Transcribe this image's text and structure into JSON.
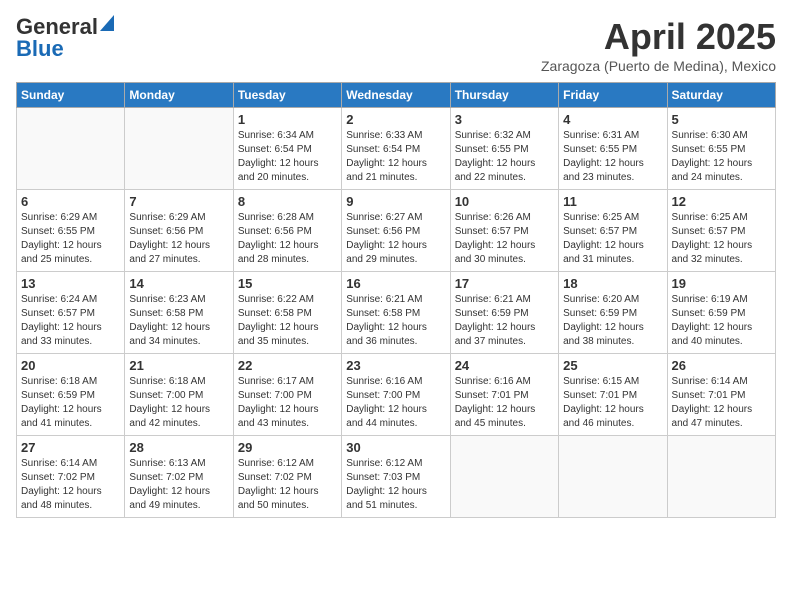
{
  "header": {
    "logo_general": "General",
    "logo_blue": "Blue",
    "month_title": "April 2025",
    "location": "Zaragoza (Puerto de Medina), Mexico"
  },
  "days_of_week": [
    "Sunday",
    "Monday",
    "Tuesday",
    "Wednesday",
    "Thursday",
    "Friday",
    "Saturday"
  ],
  "weeks": [
    [
      {
        "day": "",
        "info": ""
      },
      {
        "day": "",
        "info": ""
      },
      {
        "day": "1",
        "info": "Sunrise: 6:34 AM\nSunset: 6:54 PM\nDaylight: 12 hours and 20 minutes."
      },
      {
        "day": "2",
        "info": "Sunrise: 6:33 AM\nSunset: 6:54 PM\nDaylight: 12 hours and 21 minutes."
      },
      {
        "day": "3",
        "info": "Sunrise: 6:32 AM\nSunset: 6:55 PM\nDaylight: 12 hours and 22 minutes."
      },
      {
        "day": "4",
        "info": "Sunrise: 6:31 AM\nSunset: 6:55 PM\nDaylight: 12 hours and 23 minutes."
      },
      {
        "day": "5",
        "info": "Sunrise: 6:30 AM\nSunset: 6:55 PM\nDaylight: 12 hours and 24 minutes."
      }
    ],
    [
      {
        "day": "6",
        "info": "Sunrise: 6:29 AM\nSunset: 6:55 PM\nDaylight: 12 hours and 25 minutes."
      },
      {
        "day": "7",
        "info": "Sunrise: 6:29 AM\nSunset: 6:56 PM\nDaylight: 12 hours and 27 minutes."
      },
      {
        "day": "8",
        "info": "Sunrise: 6:28 AM\nSunset: 6:56 PM\nDaylight: 12 hours and 28 minutes."
      },
      {
        "day": "9",
        "info": "Sunrise: 6:27 AM\nSunset: 6:56 PM\nDaylight: 12 hours and 29 minutes."
      },
      {
        "day": "10",
        "info": "Sunrise: 6:26 AM\nSunset: 6:57 PM\nDaylight: 12 hours and 30 minutes."
      },
      {
        "day": "11",
        "info": "Sunrise: 6:25 AM\nSunset: 6:57 PM\nDaylight: 12 hours and 31 minutes."
      },
      {
        "day": "12",
        "info": "Sunrise: 6:25 AM\nSunset: 6:57 PM\nDaylight: 12 hours and 32 minutes."
      }
    ],
    [
      {
        "day": "13",
        "info": "Sunrise: 6:24 AM\nSunset: 6:57 PM\nDaylight: 12 hours and 33 minutes."
      },
      {
        "day": "14",
        "info": "Sunrise: 6:23 AM\nSunset: 6:58 PM\nDaylight: 12 hours and 34 minutes."
      },
      {
        "day": "15",
        "info": "Sunrise: 6:22 AM\nSunset: 6:58 PM\nDaylight: 12 hours and 35 minutes."
      },
      {
        "day": "16",
        "info": "Sunrise: 6:21 AM\nSunset: 6:58 PM\nDaylight: 12 hours and 36 minutes."
      },
      {
        "day": "17",
        "info": "Sunrise: 6:21 AM\nSunset: 6:59 PM\nDaylight: 12 hours and 37 minutes."
      },
      {
        "day": "18",
        "info": "Sunrise: 6:20 AM\nSunset: 6:59 PM\nDaylight: 12 hours and 38 minutes."
      },
      {
        "day": "19",
        "info": "Sunrise: 6:19 AM\nSunset: 6:59 PM\nDaylight: 12 hours and 40 minutes."
      }
    ],
    [
      {
        "day": "20",
        "info": "Sunrise: 6:18 AM\nSunset: 6:59 PM\nDaylight: 12 hours and 41 minutes."
      },
      {
        "day": "21",
        "info": "Sunrise: 6:18 AM\nSunset: 7:00 PM\nDaylight: 12 hours and 42 minutes."
      },
      {
        "day": "22",
        "info": "Sunrise: 6:17 AM\nSunset: 7:00 PM\nDaylight: 12 hours and 43 minutes."
      },
      {
        "day": "23",
        "info": "Sunrise: 6:16 AM\nSunset: 7:00 PM\nDaylight: 12 hours and 44 minutes."
      },
      {
        "day": "24",
        "info": "Sunrise: 6:16 AM\nSunset: 7:01 PM\nDaylight: 12 hours and 45 minutes."
      },
      {
        "day": "25",
        "info": "Sunrise: 6:15 AM\nSunset: 7:01 PM\nDaylight: 12 hours and 46 minutes."
      },
      {
        "day": "26",
        "info": "Sunrise: 6:14 AM\nSunset: 7:01 PM\nDaylight: 12 hours and 47 minutes."
      }
    ],
    [
      {
        "day": "27",
        "info": "Sunrise: 6:14 AM\nSunset: 7:02 PM\nDaylight: 12 hours and 48 minutes."
      },
      {
        "day": "28",
        "info": "Sunrise: 6:13 AM\nSunset: 7:02 PM\nDaylight: 12 hours and 49 minutes."
      },
      {
        "day": "29",
        "info": "Sunrise: 6:12 AM\nSunset: 7:02 PM\nDaylight: 12 hours and 50 minutes."
      },
      {
        "day": "30",
        "info": "Sunrise: 6:12 AM\nSunset: 7:03 PM\nDaylight: 12 hours and 51 minutes."
      },
      {
        "day": "",
        "info": ""
      },
      {
        "day": "",
        "info": ""
      },
      {
        "day": "",
        "info": ""
      }
    ]
  ]
}
